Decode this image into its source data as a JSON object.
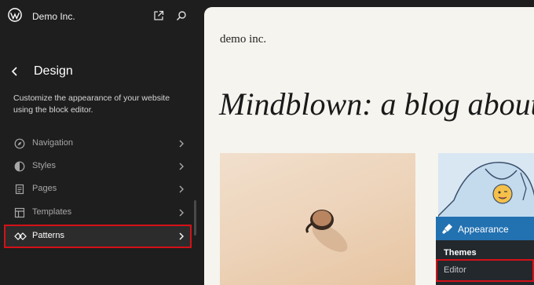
{
  "header": {
    "site_name": "Demo Inc."
  },
  "panel": {
    "title": "Design",
    "description": "Customize the appearance of your website using the block editor."
  },
  "nav": {
    "items": [
      {
        "label": "Navigation",
        "icon": "compass-icon"
      },
      {
        "label": "Styles",
        "icon": "half-circle-icon"
      },
      {
        "label": "Pages",
        "icon": "page-icon"
      },
      {
        "label": "Templates",
        "icon": "layout-icon"
      },
      {
        "label": "Patterns",
        "icon": "diamond-icon",
        "active": true
      }
    ]
  },
  "preview": {
    "blog_name": "demo inc.",
    "headline": "Mindblown: a blog about p"
  },
  "admin_menu": {
    "appearance": "Appearance",
    "themes": "Themes",
    "editor": "Editor"
  },
  "colors": {
    "accent": "#2271b1",
    "highlight": "#d41118",
    "sidebar_bg": "#1e1e1e"
  }
}
